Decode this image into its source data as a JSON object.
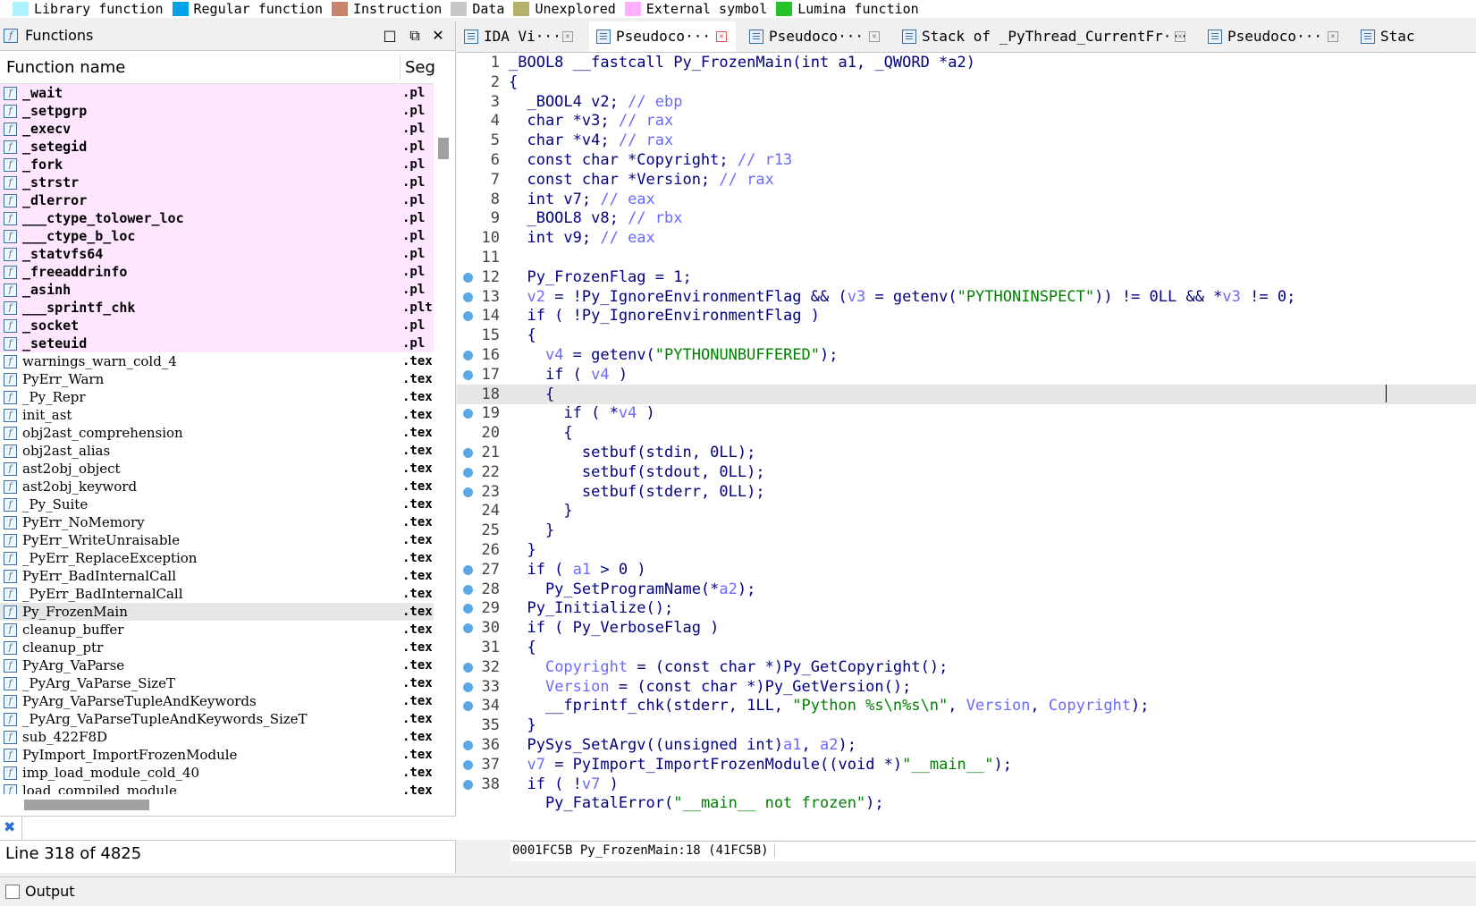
{
  "legend": [
    {
      "label": "Library function",
      "color": "#aef1ff"
    },
    {
      "label": "Regular function",
      "color": "#00a2e8"
    },
    {
      "label": "Instruction",
      "color": "#c8836c"
    },
    {
      "label": "Data",
      "color": "#c8c8c8"
    },
    {
      "label": "Unexplored",
      "color": "#b5b06a"
    },
    {
      "label": "External symbol",
      "color": "#ffb0ff"
    },
    {
      "label": "Lumina function",
      "color": "#23c32a"
    }
  ],
  "functions_panel": {
    "title": "Functions",
    "col_name": "Function name",
    "col_seg": "Seg",
    "line_info": "Line 318 of 4825",
    "rows": [
      {
        "name": "_wait",
        "seg": ".pl",
        "imp": true
      },
      {
        "name": "_setpgrp",
        "seg": ".pl",
        "imp": true
      },
      {
        "name": "_execv",
        "seg": ".pl",
        "imp": true
      },
      {
        "name": "_setegid",
        "seg": ".pl",
        "imp": true
      },
      {
        "name": "_fork",
        "seg": ".pl",
        "imp": true
      },
      {
        "name": "_strstr",
        "seg": ".pl",
        "imp": true
      },
      {
        "name": "_dlerror",
        "seg": ".pl",
        "imp": true
      },
      {
        "name": "___ctype_tolower_loc",
        "seg": ".pl",
        "imp": true
      },
      {
        "name": "___ctype_b_loc",
        "seg": ".pl",
        "imp": true
      },
      {
        "name": "_statvfs64",
        "seg": ".pl",
        "imp": true
      },
      {
        "name": "_freeaddrinfo",
        "seg": ".pl",
        "imp": true
      },
      {
        "name": "_asinh",
        "seg": ".pl",
        "imp": true
      },
      {
        "name": "___sprintf_chk",
        "seg": ".plt",
        "imp": true
      },
      {
        "name": "_socket",
        "seg": ".pl",
        "imp": true
      },
      {
        "name": "_seteuid",
        "seg": ".pl",
        "imp": true
      },
      {
        "name": "warnings_warn_cold_4",
        "seg": ".tex",
        "imp": false
      },
      {
        "name": "PyErr_Warn",
        "seg": ".tex",
        "imp": false
      },
      {
        "name": "_Py_Repr",
        "seg": ".tex",
        "imp": false
      },
      {
        "name": "init_ast",
        "seg": ".tex",
        "imp": false
      },
      {
        "name": "obj2ast_comprehension",
        "seg": ".tex",
        "imp": false
      },
      {
        "name": "obj2ast_alias",
        "seg": ".tex",
        "imp": false
      },
      {
        "name": "ast2obj_object",
        "seg": ".tex",
        "imp": false
      },
      {
        "name": "ast2obj_keyword",
        "seg": ".tex",
        "imp": false
      },
      {
        "name": "_Py_Suite",
        "seg": ".tex",
        "imp": false
      },
      {
        "name": "PyErr_NoMemory",
        "seg": ".tex",
        "imp": false
      },
      {
        "name": "PyErr_WriteUnraisable",
        "seg": ".tex",
        "imp": false
      },
      {
        "name": "_PyErr_ReplaceException",
        "seg": ".tex",
        "imp": false
      },
      {
        "name": "PyErr_BadInternalCall",
        "seg": ".tex",
        "imp": false
      },
      {
        "name": "_PyErr_BadInternalCall",
        "seg": ".tex",
        "imp": false
      },
      {
        "name": "Py_FrozenMain",
        "seg": ".tex",
        "imp": false,
        "selected": true
      },
      {
        "name": "cleanup_buffer",
        "seg": ".tex",
        "imp": false
      },
      {
        "name": "cleanup_ptr",
        "seg": ".tex",
        "imp": false
      },
      {
        "name": "PyArg_VaParse",
        "seg": ".tex",
        "imp": false
      },
      {
        "name": "_PyArg_VaParse_SizeT",
        "seg": ".tex",
        "imp": false
      },
      {
        "name": "PyArg_VaParseTupleAndKeywords",
        "seg": ".tex",
        "imp": false
      },
      {
        "name": "_PyArg_VaParseTupleAndKeywords_SizeT",
        "seg": ".tex",
        "imp": false
      },
      {
        "name": "sub_422F8D",
        "seg": ".tex",
        "imp": false
      },
      {
        "name": "PyImport_ImportFrozenModule",
        "seg": ".tex",
        "imp": false
      },
      {
        "name": "imp_load_module_cold_40",
        "seg": ".tex",
        "imp": false
      },
      {
        "name": "load_compiled_module",
        "seg": ".tex",
        "imp": false
      }
    ]
  },
  "tabs": [
    {
      "label": "IDA Vi···",
      "active": false
    },
    {
      "label": "Pseudoco···",
      "active": true
    },
    {
      "label": "Pseudoco···",
      "active": false
    },
    {
      "label": "Stack of _PyThread_CurrentFr···",
      "active": false
    },
    {
      "label": "Pseudoco···",
      "active": false
    },
    {
      "label": "Stac",
      "active": false
    }
  ],
  "code": {
    "current_line": 18,
    "status": "0001FC5B Py_FrozenMain:18 (41FC5B)",
    "lines": [
      {
        "n": "1",
        "bp": false,
        "html": "<span class=\"k\">_BOOL8 __fastcall Py_FrozenMain(int a1, _QWORD *a2)</span>"
      },
      {
        "n": "2",
        "bp": false,
        "html": "{"
      },
      {
        "n": "3",
        "bp": false,
        "html": "  _BOOL4 v2; <span class=\"c\">// ebp</span>"
      },
      {
        "n": "4",
        "bp": false,
        "html": "  char *v3; <span class=\"c\">// rax</span>"
      },
      {
        "n": "5",
        "bp": false,
        "html": "  char *v4; <span class=\"c\">// rax</span>"
      },
      {
        "n": "6",
        "bp": false,
        "html": "  const char *Copyright; <span class=\"c\">// r13</span>"
      },
      {
        "n": "7",
        "bp": false,
        "html": "  const char *Version; <span class=\"c\">// rax</span>"
      },
      {
        "n": "8",
        "bp": false,
        "html": "  int v7; <span class=\"c\">// eax</span>"
      },
      {
        "n": "9",
        "bp": false,
        "html": "  _BOOL8 v8; <span class=\"c\">// rbx</span>"
      },
      {
        "n": "10",
        "bp": false,
        "html": "  int v9; <span class=\"c\">// eax</span>"
      },
      {
        "n": "11",
        "bp": false,
        "html": ""
      },
      {
        "n": "12",
        "bp": true,
        "html": "  Py_FrozenFlag = 1;"
      },
      {
        "n": "13",
        "bp": true,
        "html": "  <span class=\"v\">v2</span> = !Py_IgnoreEnvironmentFlag &amp;&amp; (<span class=\"v\">v3</span> = getenv(<span class=\"s\">\"PYTHONINSPECT\"</span>)) != 0LL &amp;&amp; *<span class=\"v\">v3</span> != 0;"
      },
      {
        "n": "14",
        "bp": true,
        "html": "  if ( !Py_IgnoreEnvironmentFlag )"
      },
      {
        "n": "15",
        "bp": false,
        "html": "  {"
      },
      {
        "n": "16",
        "bp": true,
        "html": "    <span class=\"v\">v4</span> = getenv(<span class=\"s\">\"PYTHONUNBUFFERED\"</span>);"
      },
      {
        "n": "17",
        "bp": true,
        "html": "    if ( <span class=\"v\">v4</span> )"
      },
      {
        "n": "18",
        "bp": false,
        "html": "    {"
      },
      {
        "n": "19",
        "bp": true,
        "html": "      if ( *<span class=\"v\">v4</span> )"
      },
      {
        "n": "20",
        "bp": false,
        "html": "      {"
      },
      {
        "n": "21",
        "bp": true,
        "html": "        setbuf(stdin, 0LL);"
      },
      {
        "n": "22",
        "bp": true,
        "html": "        setbuf(stdout, 0LL);"
      },
      {
        "n": "23",
        "bp": true,
        "html": "        setbuf(stderr, 0LL);"
      },
      {
        "n": "24",
        "bp": false,
        "html": "      }"
      },
      {
        "n": "25",
        "bp": false,
        "html": "    }"
      },
      {
        "n": "26",
        "bp": false,
        "html": "  }"
      },
      {
        "n": "27",
        "bp": true,
        "html": "  if ( <span class=\"v\">a1</span> &gt; 0 )"
      },
      {
        "n": "28",
        "bp": true,
        "html": "    Py_SetProgramName(*<span class=\"v\">a2</span>);"
      },
      {
        "n": "29",
        "bp": true,
        "html": "  Py_Initialize();"
      },
      {
        "n": "30",
        "bp": true,
        "html": "  if ( Py_VerboseFlag )"
      },
      {
        "n": "31",
        "bp": false,
        "html": "  {"
      },
      {
        "n": "32",
        "bp": true,
        "html": "    <span class=\"v\">Copyright</span> = (const char *)Py_GetCopyright();"
      },
      {
        "n": "33",
        "bp": true,
        "html": "    <span class=\"v\">Version</span> = (const char *)Py_GetVersion();"
      },
      {
        "n": "34",
        "bp": true,
        "html": "    __fprintf_chk(stderr, 1LL, <span class=\"s\">\"Python %s\\n%s\\n\"</span>, <span class=\"v\">Version</span>, <span class=\"v\">Copyright</span>);"
      },
      {
        "n": "35",
        "bp": false,
        "html": "  }"
      },
      {
        "n": "36",
        "bp": true,
        "html": "  PySys_SetArgv((unsigned int)<span class=\"v\">a1</span>, <span class=\"v\">a2</span>);"
      },
      {
        "n": "37",
        "bp": true,
        "html": "  <span class=\"v\">v7</span> = PyImport_ImportFrozenModule((void *)<span class=\"s\">\"__main__\"</span>);"
      },
      {
        "n": "38",
        "bp": true,
        "html": "  if ( !<span class=\"v\">v7</span> )"
      },
      {
        "n": "",
        "bp": false,
        "html": "    Py_FatalError(<span class=\"s\">\"__main__ not frozen\"</span>);"
      }
    ]
  },
  "output": {
    "label": "Output"
  }
}
